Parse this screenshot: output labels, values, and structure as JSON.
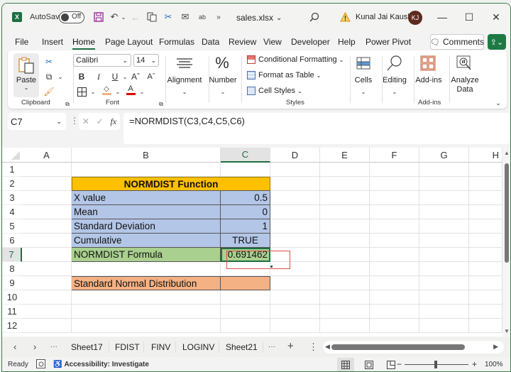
{
  "titlebar": {
    "app_icon": "excel-icon",
    "autosave_label": "AutoSave",
    "autosave_state": "Off",
    "quick_access": [
      "save-icon",
      "undo-icon",
      "undo-dropdown-icon",
      "redo-arrow-icon",
      "copy-icon",
      "cut-icon",
      "email-icon",
      "spelling-icon",
      "more-commands-icon"
    ],
    "more_label": "»",
    "filename": "sales.xlsx",
    "filename_chevron": "⌄",
    "search_icon": "search-icon",
    "warning_icon": "warning-icon",
    "user_name": "Kunal Jai Kaushik",
    "user_initials": "KJ",
    "minimize": "—",
    "maximize": "☐",
    "close": "✕"
  },
  "menu": {
    "tabs": [
      "File",
      "Insert",
      "Home",
      "Page Layout",
      "Formulas",
      "Data",
      "Review",
      "View",
      "Developer",
      "Help",
      "Power Pivot"
    ],
    "active_tab": "Home",
    "comments_label": "Comments",
    "share_icon": "share-icon"
  },
  "ribbon": {
    "clipboard": {
      "paste_label": "Paste",
      "group_label": "Clipboard"
    },
    "font": {
      "font_name": "Calibri",
      "font_size": "14",
      "bold": "B",
      "italic": "I",
      "underline": "U",
      "grow": "Aˆ",
      "shrink": "Aˇ",
      "font_color_letter": "A",
      "group_label": "Font"
    },
    "alignment_label": "Alignment",
    "number_label": "Number",
    "styles": {
      "conditional_formatting": "Conditional Formatting",
      "format_as_table": "Format as Table",
      "cell_styles": "Cell Styles",
      "group_label": "Styles"
    },
    "cells_label": "Cells",
    "editing_label": "Editing",
    "addins": {
      "button_label": "Add-ins",
      "group_label": "Add-ins"
    },
    "analyze_data_label": "Analyze Data",
    "colors": {
      "fill_color": "#f4b183",
      "font_color": "#e00000",
      "brand": "#1d6f42"
    }
  },
  "formula_bar": {
    "name_box": "C7",
    "cancel": "✕",
    "enter": "✓",
    "fx": "fx",
    "formula": "=NORMDIST(C3,C4,C5,C6)"
  },
  "sheet": {
    "columns": [
      "A",
      "B",
      "C",
      "D",
      "E",
      "F",
      "G",
      "H"
    ],
    "selected_column": "C",
    "rows": [
      "1",
      "2",
      "3",
      "4",
      "5",
      "6",
      "7",
      "8",
      "9",
      "10",
      "11",
      "12"
    ],
    "selected_row": "7",
    "active_cell": "C7",
    "table": {
      "title": "NORMDIST Function",
      "x_value_label": "X value",
      "x_value": "0.5",
      "mean_label": "Mean",
      "mean": "0",
      "stddev_label": "Standard Deviation",
      "stddev": "1",
      "cumulative_label": "Cumulative",
      "cumulative": "TRUE",
      "formula_label": "NORMDIST Formula",
      "formula_result": "0.691462",
      "snd_label": "Standard Normal Distribution",
      "snd_value": ""
    },
    "fill_colors": {
      "header": "#ffc000",
      "inputs": "#b4c6e7",
      "result": "#a9d08e",
      "snd": "#f4b183",
      "highlight_box": "#d9534f"
    }
  },
  "sheet_tabs": {
    "prev": "‹",
    "next": "›",
    "more_left": "···",
    "tabs": [
      "Sheet17",
      "FDIST",
      "FINV",
      "LOGINV",
      "Sheet21"
    ],
    "more_right": "···",
    "add": "+",
    "options": "⋮"
  },
  "status_bar": {
    "ready": "Ready",
    "macro_icon": "macro-recording-icon",
    "accessibility": "Accessibility: Investigate",
    "views": [
      "normal-view-icon",
      "page-layout-view-icon",
      "page-break-preview-icon"
    ],
    "zoom_out": "−",
    "zoom_in": "+",
    "zoom_level": "100%",
    "zoom_percent": 100
  }
}
